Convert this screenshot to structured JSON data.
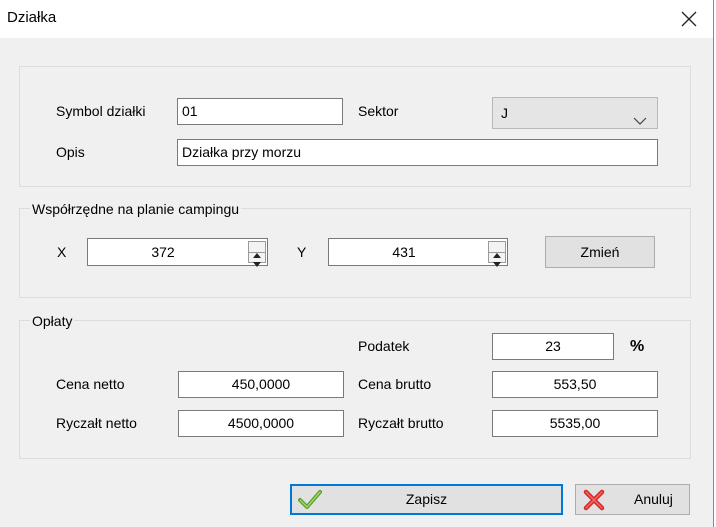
{
  "window": {
    "title": "Działka"
  },
  "fields": {
    "symbol_label": "Symbol działki",
    "symbol_value": "01",
    "sector_label": "Sektor",
    "sector_value": "J",
    "description_label": "Opis",
    "description_value": "Działka przy morzu"
  },
  "coordinates": {
    "legend": "Współrzędne na planie campingu",
    "x_label": "X",
    "x_value": "372",
    "y_label": "Y",
    "y_value": "431",
    "change_button": "Zmień"
  },
  "fees": {
    "legend": "Opłaty",
    "tax_label": "Podatek",
    "tax_value": "23",
    "tax_unit": "%",
    "net_price_label": "Cena netto",
    "net_price_value": "450,0000",
    "gross_price_label": "Cena brutto",
    "gross_price_value": "553,50",
    "flat_net_label": "Ryczałt netto",
    "flat_net_value": "4500,0000",
    "flat_gross_label": "Ryczałt brutto",
    "flat_gross_value": "5535,00"
  },
  "buttons": {
    "save": "Zapisz",
    "cancel": "Anuluj"
  },
  "icons": {
    "save": "check-icon",
    "cancel": "x-icon",
    "close": "close-icon",
    "dropdown": "chevron-down-icon"
  }
}
